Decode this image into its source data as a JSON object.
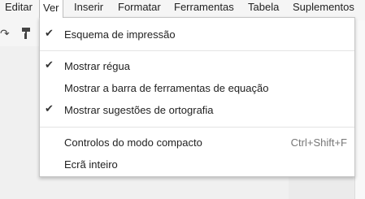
{
  "menubar": {
    "items": [
      {
        "label": "Editar",
        "active": false
      },
      {
        "label": "Ver",
        "active": true
      },
      {
        "label": "Inserir",
        "active": false
      },
      {
        "label": "Formatar",
        "active": false
      },
      {
        "label": "Ferramentas",
        "active": false
      },
      {
        "label": "Tabela",
        "active": false
      },
      {
        "label": "Suplementos",
        "active": false
      }
    ]
  },
  "toolbar": {
    "redo_icon": "redo-icon",
    "paint_format_icon": "paint-format-icon"
  },
  "view_menu": {
    "items": [
      {
        "label": "Esquema de impressão",
        "checked": true,
        "shortcut": ""
      },
      {
        "label": "Mostrar régua",
        "checked": true,
        "shortcut": ""
      },
      {
        "label": "Mostrar a barra de ferramentas de equação",
        "checked": false,
        "shortcut": ""
      },
      {
        "label": "Mostrar sugestões de ortografia",
        "checked": true,
        "shortcut": ""
      },
      {
        "label": "Controlos do modo compacto",
        "checked": false,
        "shortcut": "Ctrl+Shift+F"
      },
      {
        "label": "Ecrã inteiro",
        "checked": false,
        "shortcut": ""
      }
    ]
  },
  "colors": {
    "menubar_bg": "#f5f5f5",
    "dropdown_bg": "#ffffff",
    "check": "#333333",
    "shortcut": "#777777"
  }
}
